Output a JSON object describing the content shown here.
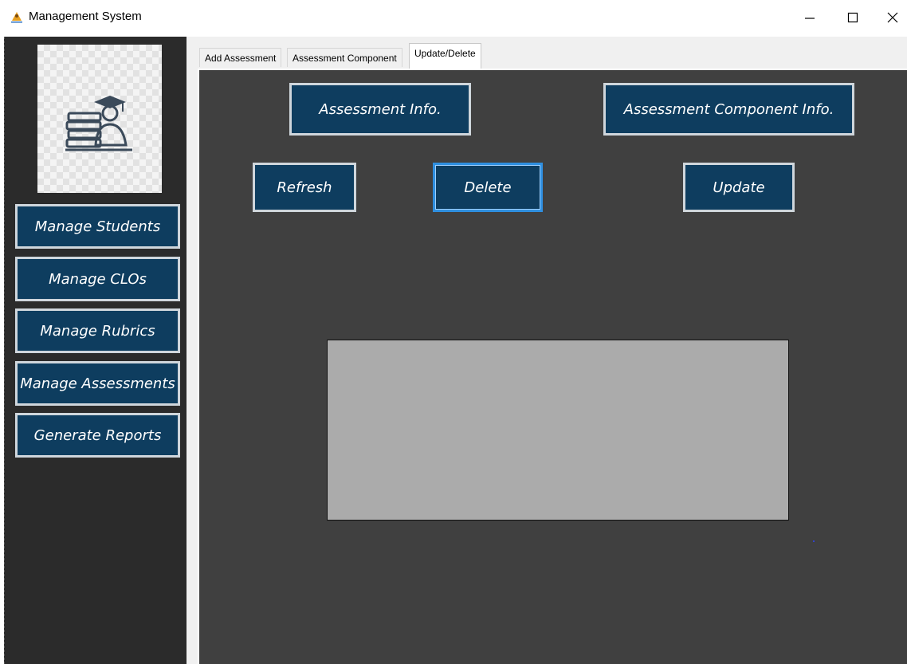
{
  "window": {
    "title": "Management System",
    "icons": [
      "app-icon",
      "minimize-icon",
      "maximize-icon",
      "close-icon"
    ]
  },
  "sidebar": {
    "logo_icon": "student-with-books-icon",
    "items": [
      {
        "label": "Manage Students"
      },
      {
        "label": "Manage CLOs"
      },
      {
        "label": "Manage Rubrics"
      },
      {
        "label": "Manage Assessments"
      },
      {
        "label": "Generate Reports"
      }
    ]
  },
  "tabs": [
    {
      "label": "Add Assessment",
      "active": false
    },
    {
      "label": "Assessment Component",
      "active": false
    },
    {
      "label": "Update/Delete",
      "active": true
    }
  ],
  "main": {
    "assessment_info_label": "Assessment Info.",
    "assessment_component_info_label": "Assessment Component Info.",
    "refresh_label": "Refresh",
    "delete_label": "Delete",
    "update_label": "Update"
  },
  "colors": {
    "button_bg": "#0e3d5f",
    "button_border": "#cfd6dc",
    "content_bg": "#404040",
    "sidebar_bg": "#2b2b2b",
    "grid_bg": "#ababab",
    "focus_border": "#2f8fe0"
  }
}
